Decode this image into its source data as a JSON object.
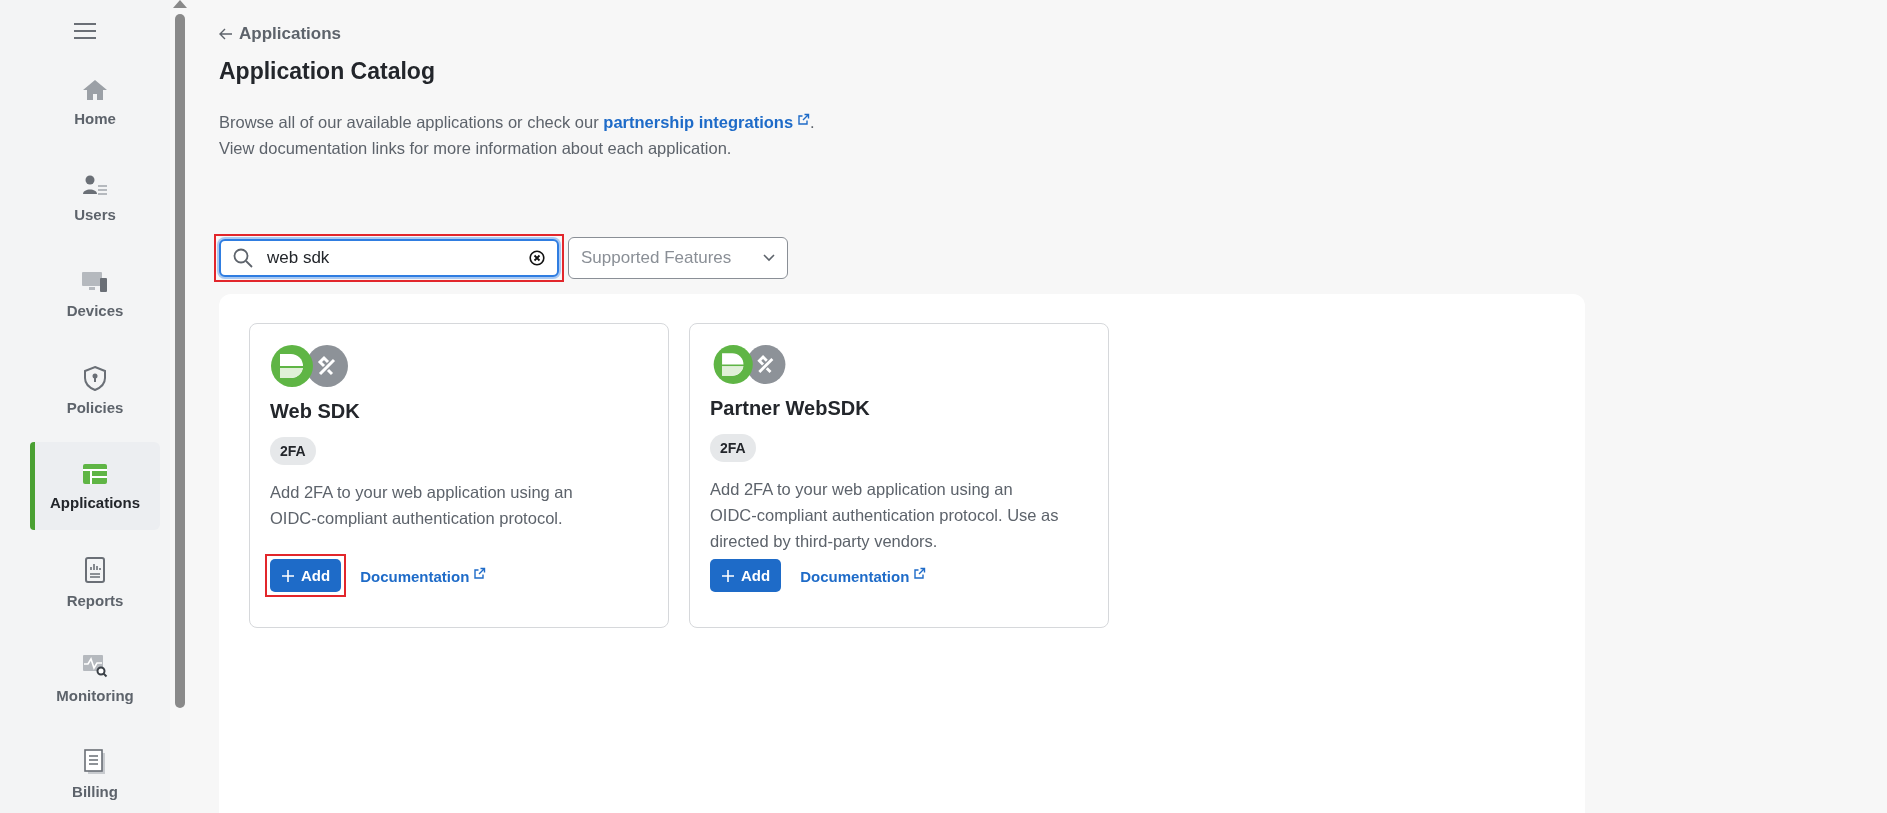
{
  "sidebar": {
    "items": [
      {
        "label": "Home",
        "selected": false
      },
      {
        "label": "Users",
        "selected": false
      },
      {
        "label": "Devices",
        "selected": false
      },
      {
        "label": "Policies",
        "selected": false
      },
      {
        "label": "Applications",
        "selected": true
      },
      {
        "label": "Reports",
        "selected": false
      },
      {
        "label": "Monitoring",
        "selected": false
      },
      {
        "label": "Billing",
        "selected": false
      }
    ]
  },
  "breadcrumb": "Applications",
  "title": "Application Catalog",
  "description": {
    "before": "Browse all of our available applications or check our",
    "link": "partnership integrations",
    "after": ".",
    "line2": "View documentation links for more information about each application."
  },
  "search": {
    "value": "web sdk",
    "highlighted": true
  },
  "filter": {
    "placeholder": "Supported Features"
  },
  "cards": [
    {
      "title": "Web SDK",
      "tag": "2FA",
      "text": "Add 2FA to your web application using an OIDC-compliant authentication protocol.",
      "add": "Add",
      "add_highlighted": true,
      "doc": "Documentation"
    },
    {
      "title": "Partner WebSDK",
      "tag": "2FA",
      "text": "Add 2FA to your web application using an OIDC-compliant authentication protocol. Use as directed by third-party vendors.",
      "add": "Add",
      "add_highlighted": false,
      "doc": "Documentation"
    }
  ]
}
